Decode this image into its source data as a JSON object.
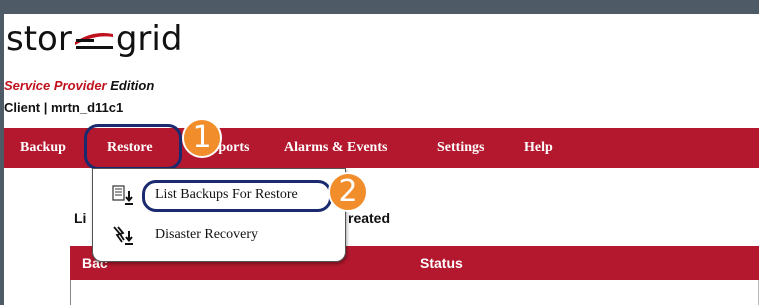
{
  "brand": {
    "logo_left": "stor",
    "logo_right": "grid",
    "edition_main": "Service Provider",
    "edition_suffix": "Edition"
  },
  "client": {
    "label": "Client | mrtn_d11c1"
  },
  "nav": {
    "items": [
      {
        "label": "Backup"
      },
      {
        "label": "Restore"
      },
      {
        "label": "Reports"
      },
      {
        "label": "Alarms & Events"
      },
      {
        "label": "Settings"
      },
      {
        "label": "Help"
      }
    ]
  },
  "dropdown": {
    "items": [
      {
        "label": "List Backups For Restore",
        "icon": "list-restore-icon"
      },
      {
        "label": "Disaster Recovery",
        "icon": "disaster-recovery-icon"
      }
    ]
  },
  "callouts": {
    "first": "1",
    "second": "2"
  },
  "section": {
    "title_left": "Li",
    "title_right": "reated"
  },
  "table": {
    "columns": [
      {
        "label": "Bac"
      },
      {
        "label": "Status"
      }
    ]
  },
  "colors": {
    "accent": "#b3182e",
    "callout": "#f18d2a",
    "highlight_border": "#1a2a6e"
  }
}
